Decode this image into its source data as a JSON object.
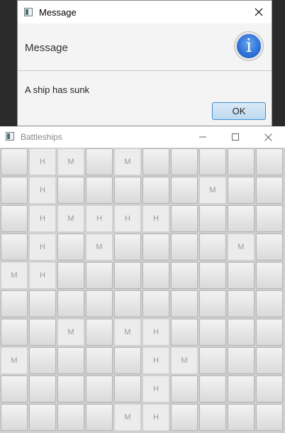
{
  "dialog": {
    "title": "Message",
    "header_text": "Message",
    "info_icon": "i",
    "content": "A ship has sunk",
    "ok_label": "OK"
  },
  "game": {
    "title": "Battleships",
    "board": [
      [
        "",
        "H",
        "M",
        "",
        "M",
        "",
        "",
        "",
        "",
        ""
      ],
      [
        "",
        "H",
        "",
        "",
        "",
        "",
        "",
        "M",
        "",
        ""
      ],
      [
        "",
        "H",
        "M",
        "H",
        "H",
        "H",
        "",
        "",
        "",
        ""
      ],
      [
        "",
        "H",
        "",
        "M",
        "",
        "",
        "",
        "",
        "M",
        ""
      ],
      [
        "M",
        "H",
        "",
        "",
        "",
        "",
        "",
        "",
        "",
        ""
      ],
      [
        "",
        "",
        "",
        "",
        "",
        "",
        "",
        "",
        "",
        ""
      ],
      [
        "",
        "",
        "M",
        "",
        "M",
        "H",
        "",
        "",
        "",
        ""
      ],
      [
        "M",
        "",
        "",
        "",
        "",
        "H",
        "M",
        "",
        "",
        ""
      ],
      [
        "",
        "",
        "",
        "",
        "",
        "H",
        "",
        "",
        "",
        ""
      ],
      [
        "",
        "",
        "",
        "",
        "M",
        "H",
        "",
        "",
        "",
        ""
      ]
    ]
  }
}
